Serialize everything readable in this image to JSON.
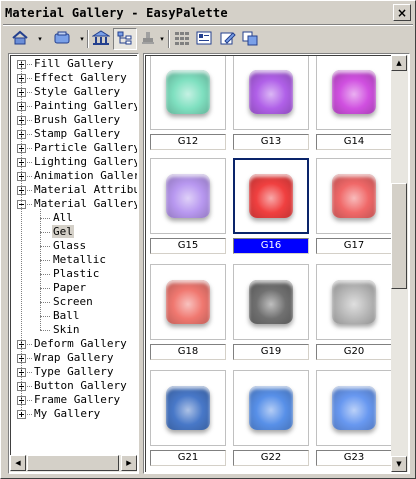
{
  "window": {
    "title": "Material Gallery - EasyPalette",
    "close_label": "×"
  },
  "toolbar": {
    "buttons": [
      {
        "name": "gallery-home-icon",
        "dropdown": true
      },
      {
        "name": "palette-icon",
        "dropdown": true
      },
      {
        "name": "bank-icon",
        "dropdown": false
      },
      {
        "name": "tree-view-icon",
        "dropdown": false,
        "pressed": true
      },
      {
        "name": "stamp-icon",
        "dropdown": true
      },
      {
        "name": "grid-view-icon",
        "dropdown": false
      },
      {
        "name": "card-view-icon",
        "dropdown": false
      },
      {
        "name": "edit-icon",
        "dropdown": false
      },
      {
        "name": "copy-icon",
        "dropdown": false
      }
    ],
    "dropdown_glyph": "▾"
  },
  "tree": {
    "items": [
      {
        "label": "Fill Gallery",
        "level": 0,
        "expanded": false
      },
      {
        "label": "Effect Gallery",
        "level": 0,
        "expanded": false
      },
      {
        "label": "Style Gallery",
        "level": 0,
        "expanded": false
      },
      {
        "label": "Painting Gallery",
        "level": 0,
        "expanded": false
      },
      {
        "label": "Brush Gallery",
        "level": 0,
        "expanded": false
      },
      {
        "label": "Stamp Gallery",
        "level": 0,
        "expanded": false
      },
      {
        "label": "Particle Gallery",
        "level": 0,
        "expanded": false
      },
      {
        "label": "Lighting Gallery",
        "level": 0,
        "expanded": false
      },
      {
        "label": "Animation Gallery",
        "level": 0,
        "expanded": false
      },
      {
        "label": "Material Attribute",
        "level": 0,
        "expanded": false
      },
      {
        "label": "Material Gallery",
        "level": 0,
        "expanded": true
      },
      {
        "label": "All",
        "level": 1
      },
      {
        "label": "Gel",
        "level": 1,
        "selected": true
      },
      {
        "label": "Glass",
        "level": 1
      },
      {
        "label": "Metallic",
        "level": 1
      },
      {
        "label": "Plastic",
        "level": 1
      },
      {
        "label": "Paper",
        "level": 1
      },
      {
        "label": "Screen",
        "level": 1
      },
      {
        "label": "Ball",
        "level": 1
      },
      {
        "label": "Skin",
        "level": 1
      },
      {
        "label": "Deform Gallery",
        "level": 0,
        "expanded": false
      },
      {
        "label": "Wrap Gallery",
        "level": 0,
        "expanded": false
      },
      {
        "label": "Type Gallery",
        "level": 0,
        "expanded": false
      },
      {
        "label": "Button Gallery",
        "level": 0,
        "expanded": false
      },
      {
        "label": "Frame Gallery",
        "level": 0,
        "expanded": false
      },
      {
        "label": "My Gallery",
        "level": 0,
        "expanded": false
      }
    ]
  },
  "gallery": {
    "items": [
      {
        "label": "G12",
        "color": "#7fe0c0",
        "selected": false
      },
      {
        "label": "G13",
        "color": "#b060e8",
        "selected": false
      },
      {
        "label": "G14",
        "color": "#d050e0",
        "selected": false
      },
      {
        "label": "G15",
        "color": "#b898f0",
        "selected": false
      },
      {
        "label": "G16",
        "color": "#f04040",
        "selected": true
      },
      {
        "label": "G17",
        "color": "#f06868",
        "selected": false
      },
      {
        "label": "G18",
        "color": "#f07870",
        "selected": false
      },
      {
        "label": "G19",
        "color": "#707070",
        "selected": false
      },
      {
        "label": "G20",
        "color": "#b8b8b8",
        "selected": false
      },
      {
        "label": "G21",
        "color": "#4878c8",
        "selected": false
      },
      {
        "label": "G22",
        "color": "#5890e8",
        "selected": false
      },
      {
        "label": "G23",
        "color": "#6898f0",
        "selected": false
      }
    ],
    "selected_caption_bg": "#0000ff"
  },
  "scrollbars": {
    "left_arrow": "◀",
    "right_arrow": "▶",
    "up_arrow": "▲",
    "down_arrow": "▼"
  }
}
